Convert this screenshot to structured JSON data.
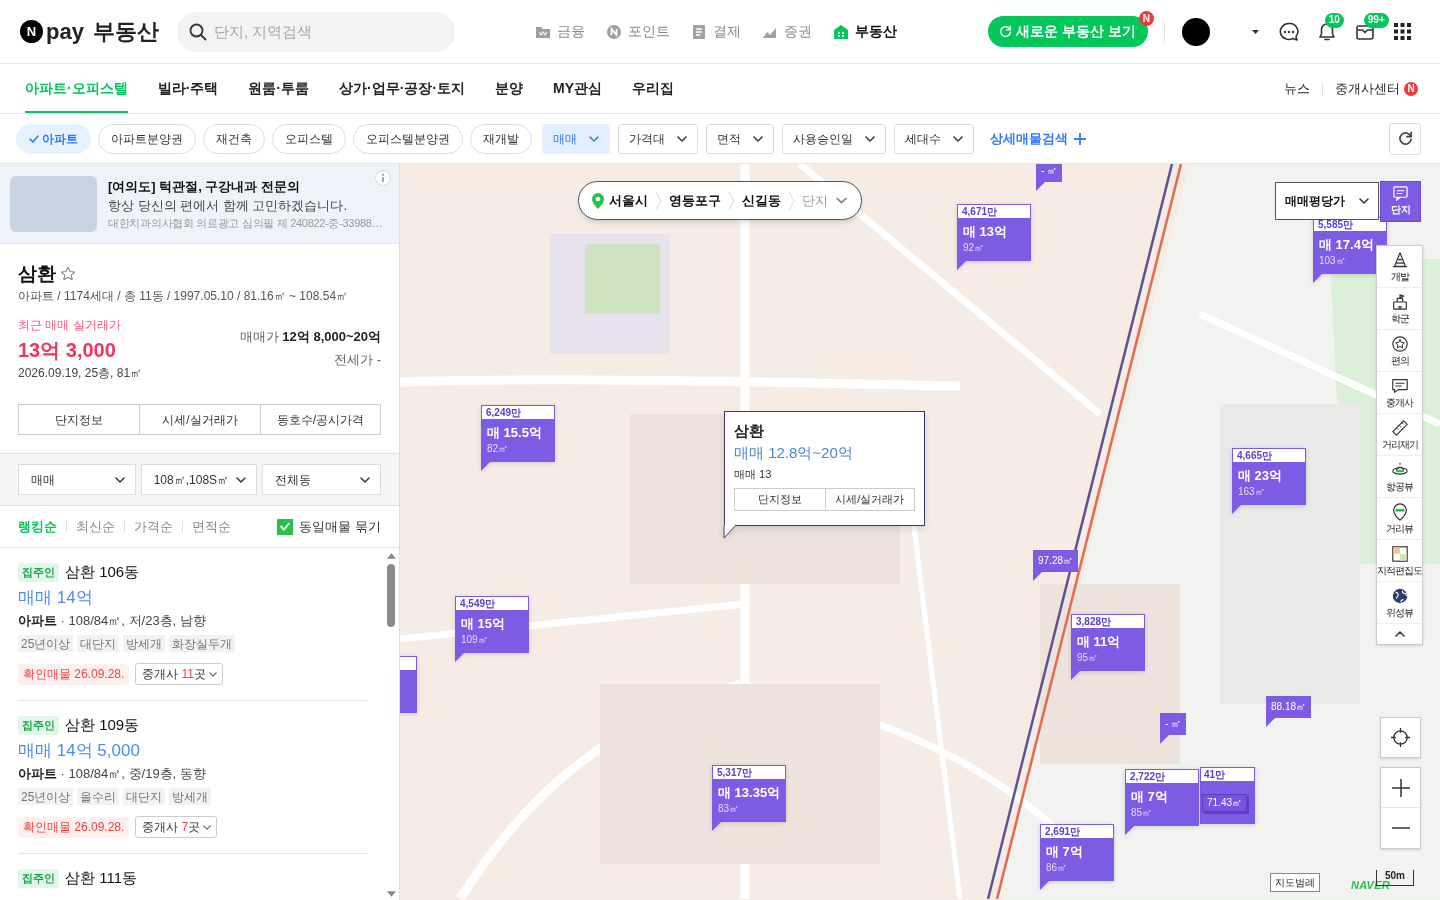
{
  "header": {
    "logo": {
      "mark": "N",
      "word": "pay",
      "service": "부동산"
    },
    "search": {
      "placeholder": "단지, 지역검색"
    },
    "nav": [
      {
        "kind": "finance",
        "label": "금융",
        "selected": false
      },
      {
        "kind": "point",
        "label": "포인트",
        "selected": false
      },
      {
        "kind": "payment",
        "label": "결제",
        "selected": false
      },
      {
        "kind": "stock",
        "label": "증권",
        "selected": false
      },
      {
        "kind": "realty",
        "label": "부동산",
        "selected": true
      }
    ],
    "new_button": {
      "label": "새로운 부동산 보기",
      "badge": "N"
    },
    "notifications": {
      "badge": "10"
    },
    "messages": {
      "badge": "99+"
    }
  },
  "category_tabs": [
    {
      "label": "아파트·오피스텔",
      "selected": true
    },
    {
      "label": "빌라·주택",
      "selected": false
    },
    {
      "label": "원룸·투룸",
      "selected": false
    },
    {
      "label": "상가·업무·공장·토지",
      "selected": false
    },
    {
      "label": "분양",
      "selected": false
    },
    {
      "label": "MY관심",
      "selected": false
    },
    {
      "label": "우리집",
      "selected": false
    }
  ],
  "header_links": [
    {
      "label": "뉴스"
    },
    {
      "label": "중개사센터",
      "badge": "N"
    }
  ],
  "filters": {
    "chips": [
      {
        "label": "아파트",
        "selected": true
      },
      {
        "label": "아파트분양권",
        "selected": false
      },
      {
        "label": "재건축",
        "selected": false
      },
      {
        "label": "오피스텔",
        "selected": false
      },
      {
        "label": "오피스텔분양권",
        "selected": false
      },
      {
        "label": "재개발",
        "selected": false
      }
    ],
    "dropdowns": [
      {
        "label": "매매",
        "selected": true
      },
      {
        "label": "가격대",
        "selected": false
      },
      {
        "label": "면적",
        "selected": false
      },
      {
        "label": "사용승인일",
        "selected": false
      },
      {
        "label": "세대수",
        "selected": false
      }
    ],
    "detail_link": "상세매물검색"
  },
  "ad": {
    "title": "[여의도] 턱관절, 구강내과 전문의",
    "text": "항상 당신의 편에서 함께 고민하겠습니다.",
    "notice": "대한치과의사협회 의료광고 심의필 제 240822-중-33988…"
  },
  "complex": {
    "name": "삼환",
    "favorite": false,
    "summary": "아파트 / 1174세대 / 총 11동 / 1997.05.10 / 81.16㎡ ~ 108.54㎡",
    "recent_label": "최근 매매 실거래가",
    "recent_price": "13억 3,000",
    "recent_detail": "2026.09.19, 25층, 81㎡",
    "sale_price": "매매가 **12억 8,000~20억**",
    "jeonse_price": "전세가 -",
    "buttons": [
      "단지정보",
      "시세/실거래가",
      "동호수/공시가격"
    ]
  },
  "listing_filters": {
    "selects": [
      "매매",
      "108㎡,108S㎡",
      "전체동"
    ],
    "sorts": [
      {
        "label": "랭킹순",
        "selected": true
      },
      {
        "label": "최신순",
        "selected": false
      },
      {
        "label": "가격순",
        "selected": false
      },
      {
        "label": "면적순",
        "selected": false
      }
    ],
    "group_same": {
      "label": "동일매물 묶기",
      "checked": true
    }
  },
  "listings": [
    {
      "tag": "집주인",
      "title": "삼환 106동",
      "price": "매매 14억",
      "spec": "**아파트** · 108/84㎡, 저/23층, 남향",
      "features": [
        "25년이상",
        "대단지",
        "방세개",
        "화장실두개"
      ],
      "verified": "확인매물 26.09.28.",
      "broker_label": "중개사",
      "broker_count": "11",
      "broker_unit": "곳"
    },
    {
      "tag": "집주인",
      "title": "삼환 109동",
      "price": "매매 14억 5,000",
      "spec": "**아파트** · 108/84㎡, 중/19층, 동향",
      "features": [
        "25년이상",
        "올수리",
        "대단지",
        "방세개"
      ],
      "verified": "확인매물 26.09.28.",
      "broker_label": "중개사",
      "broker_count": "7",
      "broker_unit": "곳"
    },
    {
      "tag": "집주인",
      "title": "삼환 111동"
    }
  ],
  "map": {
    "breadcrumb": [
      {
        "label": "서울시",
        "kind": "region"
      },
      {
        "label": "영등포구",
        "kind": "region"
      },
      {
        "label": "신길동",
        "kind": "region"
      },
      {
        "label": "단지",
        "kind": "dropdown"
      }
    ],
    "price_type": "매매평당가",
    "layer": {
      "label": "단지",
      "selected": true
    },
    "tools": [
      {
        "kind": "development",
        "label": "개발"
      },
      {
        "kind": "school",
        "label": "학군"
      },
      {
        "kind": "convenience",
        "label": "편의"
      },
      {
        "kind": "broker",
        "label": "중개사"
      },
      {
        "kind": "ruler",
        "label": "거리재기"
      },
      {
        "kind": "aerial",
        "label": "항공뷰"
      },
      {
        "kind": "street",
        "label": "거리뷰"
      },
      {
        "kind": "cadastral",
        "label": "지적편집도"
      },
      {
        "kind": "satellite",
        "label": "위성뷰"
      }
    ],
    "markers": [
      {
        "kind": "area",
        "area": "- ㎡"
      },
      {
        "kind": "full",
        "unit_price": "4,671만",
        "price": "매 13억",
        "area": "92㎡"
      },
      {
        "kind": "full",
        "unit_price": "5,585만",
        "price": "매 17.4억",
        "area": "103㎡"
      },
      {
        "kind": "full",
        "unit_price": "6,249만",
        "price": "매 15.5억",
        "area": "82㎡"
      },
      {
        "kind": "full",
        "unit_price": "4,665만",
        "price": "매 23억",
        "area": "163㎡"
      },
      {
        "kind": "area",
        "area": "97.28㎡"
      },
      {
        "kind": "full",
        "unit_price": "4,549만",
        "price": "매 15억",
        "area": "109㎡"
      },
      {
        "kind": "clipped"
      },
      {
        "kind": "full",
        "unit_price": "3,828만",
        "price": "매 11억",
        "area": "95㎡"
      },
      {
        "kind": "area",
        "area": "88.18㎡"
      },
      {
        "kind": "area",
        "area": "- ㎡"
      },
      {
        "kind": "full",
        "unit_price": "5,317만",
        "price": "매 13.35억",
        "area": "83㎡"
      },
      {
        "kind": "full",
        "unit_price": "2,722만",
        "price": "매 7억",
        "area": "85㎡"
      },
      {
        "kind": "stacked",
        "unit_price": "41만",
        "area": "71.43㎡"
      },
      {
        "kind": "full",
        "unit_price": "2,691만",
        "price": "매 7억",
        "area": "86㎡"
      }
    ],
    "popup": {
      "title": "삼환",
      "price": "매매 12.8억~20억",
      "count": "매매 13",
      "buttons": [
        "단지정보",
        "시세/실거래가"
      ]
    },
    "legend_button": "지도범례",
    "brand": "NAVER",
    "scale": "50m"
  }
}
